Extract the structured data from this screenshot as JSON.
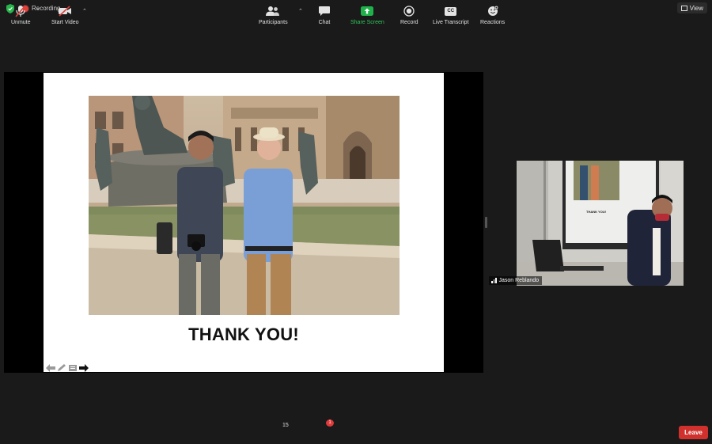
{
  "top_bar": {
    "recording_label": "Recording",
    "view_label": "View"
  },
  "slide": {
    "title": "THANK YOU!"
  },
  "participant_video": {
    "name": "Jason Reblando",
    "mini_slide_text": "THANK YOU!"
  },
  "toolbar": {
    "unmute_label": "Unmute",
    "start_video_label": "Start Video",
    "participants_label": "Participants",
    "participants_count": "15",
    "chat_label": "Chat",
    "chat_badge": "1",
    "share_screen_label": "Share Screen",
    "record_label": "Record",
    "live_transcript_label": "Live Transcript",
    "cc_icon_text": "CC",
    "reactions_label": "Reactions",
    "leave_label": "Leave"
  },
  "colors": {
    "background": "#1a1a1a",
    "share_green": "#20b24a",
    "leave_red": "#d0312d",
    "recording_red": "#e0413a"
  }
}
